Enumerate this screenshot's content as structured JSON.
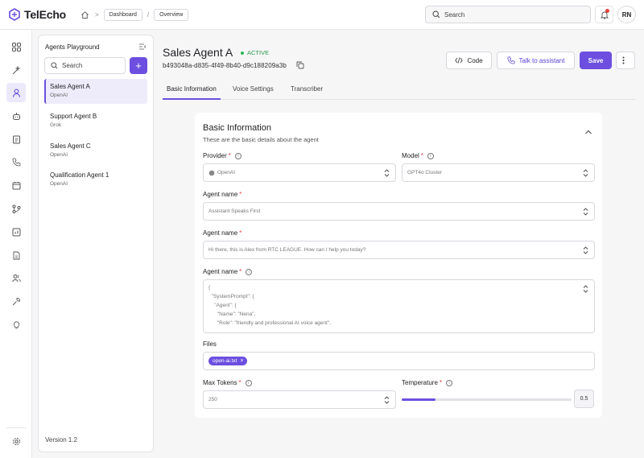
{
  "app": {
    "name": "TelEcho"
  },
  "breadcrumb": [
    "Dashboard",
    "Overview"
  ],
  "topbar": {
    "search_placeholder": "Search",
    "avatar_initials": "RN"
  },
  "sidebar_panel": {
    "title": "Agents Playground",
    "search_placeholder": "Search",
    "agents": [
      {
        "name": "Sales Agent A",
        "model": "OpenAI",
        "active": true
      },
      {
        "name": "Support Agent B",
        "model": "Grok",
        "active": false
      },
      {
        "name": "Sales Agent C",
        "model": "OpenAI",
        "active": false
      },
      {
        "name": "Qualification Agent 1",
        "model": "OpenAI",
        "active": false
      }
    ],
    "version": "Version 1.2"
  },
  "header": {
    "title": "Sales Agent A",
    "status": "ACTIVE",
    "id": "b493048a-d835-4f49-8b40-d9c188209a3b",
    "code_label": "Code",
    "talk_label": "Talk to assistant",
    "save_label": "Save"
  },
  "tabs": [
    "Basic Information",
    "Voice Settings",
    "Transcriber"
  ],
  "form": {
    "title": "Basic Information",
    "subtitle": "These are the basic details about the agent",
    "provider": {
      "label": "Provider",
      "value": "OpenAI"
    },
    "model": {
      "label": "Model",
      "value": "GPT4o Cluster"
    },
    "agent_name_1": {
      "label": "Agent name",
      "value": "Assistant Speaks First"
    },
    "agent_name_2": {
      "label": "Agent name",
      "value": "Hi there, this is Alex from RTC LEAGUE. How can I help you today?"
    },
    "agent_name_3": {
      "label": "Agent name",
      "lines": [
        "{",
        "  \"SystemPrompt\": {",
        "    \"Agent\": {",
        "      \"Name\": \"Nena\",",
        "      \"Role\": \"friendly and professional AI voice agent\","
      ]
    },
    "files": {
      "label": "Files",
      "chip": "open-ai.txt"
    },
    "max_tokens": {
      "label": "Max Tokens",
      "value": "250"
    },
    "temperature": {
      "label": "Temperature",
      "value": "0.5",
      "fill_fraction": 0.2
    }
  },
  "colors": {
    "accent": "#6c4fe0",
    "active_status": "#2a9d4a",
    "required": "#e5413d"
  },
  "icons": {
    "rail": [
      "grid-icon",
      "sparkle-icon",
      "agent-icon",
      "bot-icon",
      "notes-icon",
      "phone-icon",
      "calendar-icon",
      "branch-icon",
      "chart-icon",
      "document-icon",
      "users-icon",
      "tool-icon",
      "bulb-icon",
      "settings-icon"
    ]
  }
}
